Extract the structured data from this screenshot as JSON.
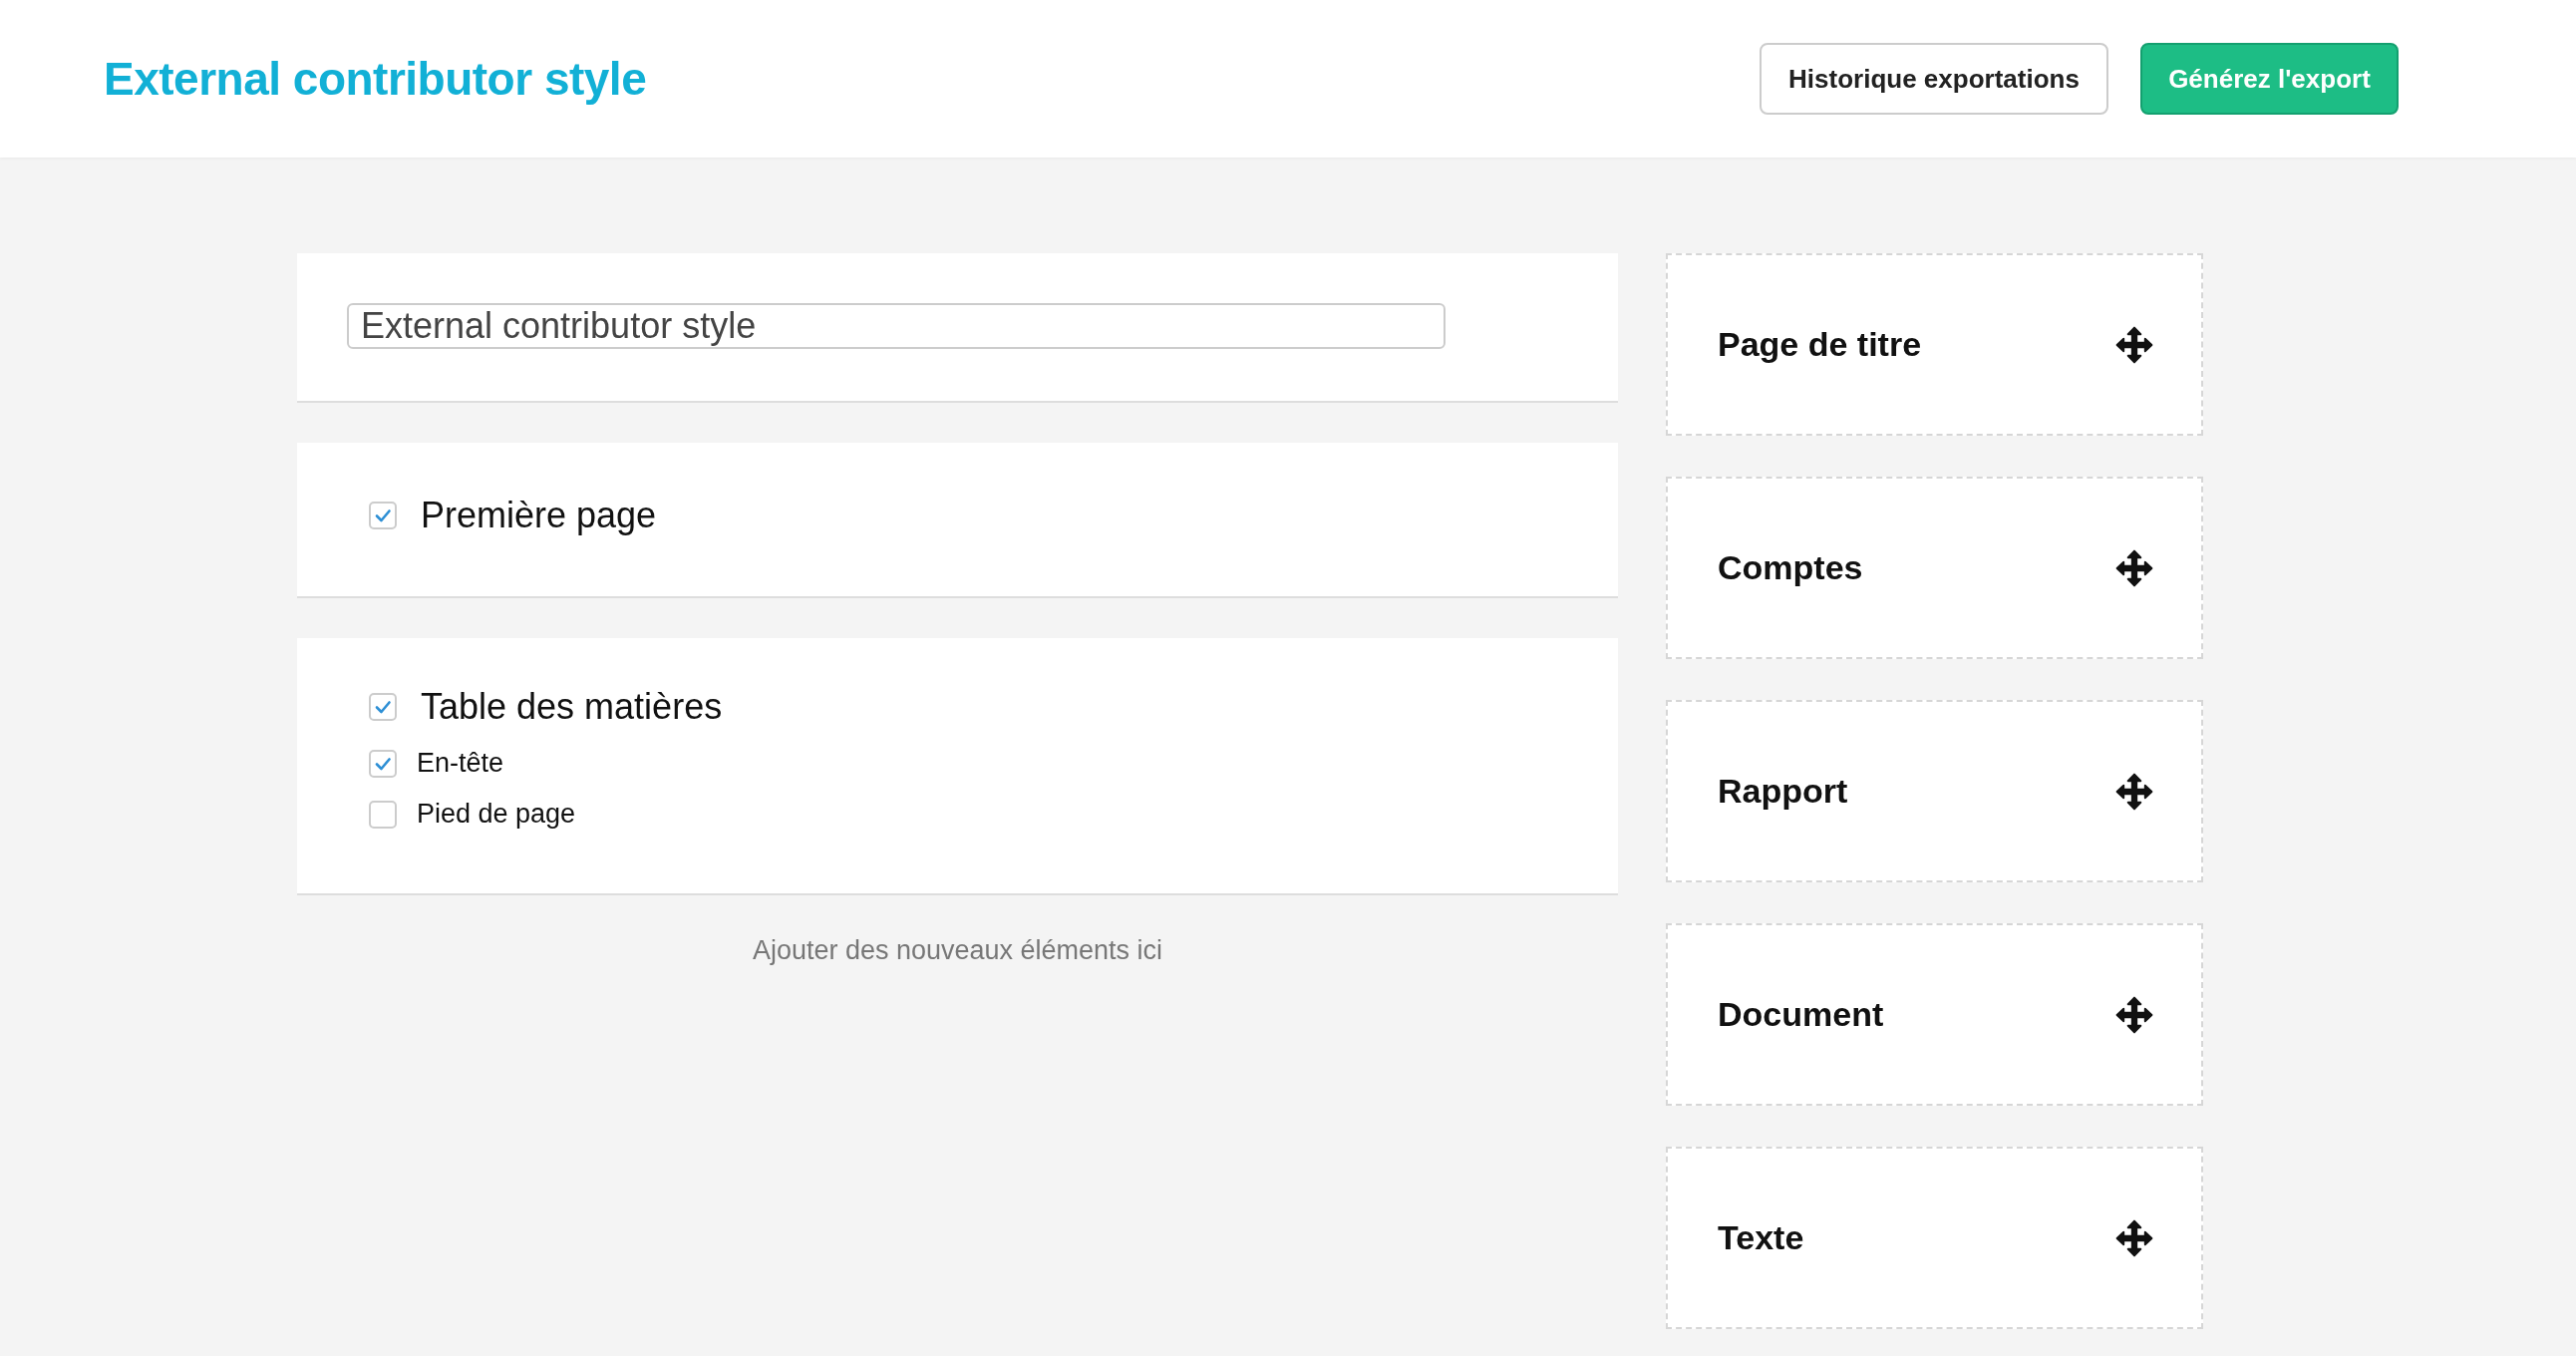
{
  "header": {
    "title": "External contributor style",
    "buttons": [
      {
        "label": "Historique exportations",
        "kind": "secondary"
      },
      {
        "label": "Générez l'export",
        "kind": "primary"
      }
    ]
  },
  "name_field": {
    "value": "External contributor style"
  },
  "sections": [
    {
      "label": "Première page",
      "checked": true
    },
    {
      "label": "Table des matières",
      "checked": true,
      "options": [
        {
          "label": "En-tête",
          "checked": true
        },
        {
          "label": "Pied de page",
          "checked": false
        }
      ]
    }
  ],
  "add_hint": "Ajouter des nouveaux éléments ici",
  "blocks": [
    {
      "label": "Page de titre"
    },
    {
      "label": "Comptes"
    },
    {
      "label": "Rapport"
    },
    {
      "label": "Document"
    },
    {
      "label": "Texte"
    }
  ]
}
